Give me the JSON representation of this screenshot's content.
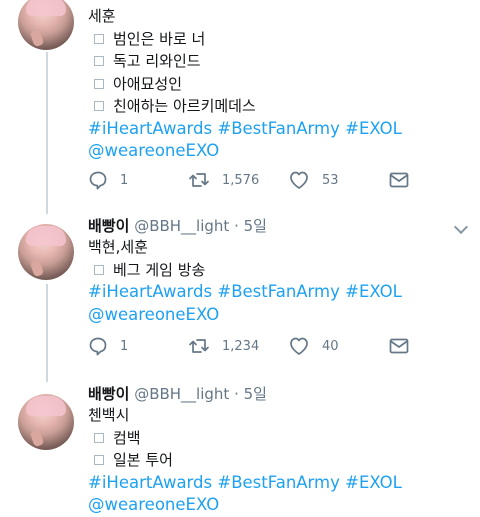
{
  "tweets": [
    {
      "text_lines": [
        "세훈"
      ],
      "bullets": [
        "범인은 바로 너",
        "독고 리와인드",
        "아애묘성인",
        "친애하는 아르키메데스"
      ],
      "hashtags": "#iHeartAwards #BestFanArmy #EXOL",
      "mention": "@weareoneEXO",
      "replies": "1",
      "retweets": "1,576",
      "likes": "53"
    },
    {
      "name": "배빵이",
      "handle": "@BBH__light",
      "time": "5일",
      "text_lines": [
        "백현,세훈"
      ],
      "bullets": [
        "베그 게임 방송"
      ],
      "hashtags": "#iHeartAwards #BestFanArmy #EXOL",
      "mention": "@weareoneEXO",
      "replies": "1",
      "retweets": "1,234",
      "likes": "40"
    },
    {
      "name": "배빵이",
      "handle": "@BBH__light",
      "time": "5일",
      "text_lines": [
        "첸백시"
      ],
      "bullets": [
        "컴백",
        "일본 투어"
      ],
      "hashtags": "#iHeartAwards #BestFanArmy #EXOL",
      "mention": "@weareoneEXO"
    }
  ],
  "separator": "·",
  "icons": [
    "reply-icon",
    "retweet-icon",
    "like-icon",
    "direct-message-icon",
    "caret-down-icon"
  ],
  "colors": {
    "link": "#1da1f2",
    "muted": "#657786",
    "thread": "#cfd8df"
  }
}
